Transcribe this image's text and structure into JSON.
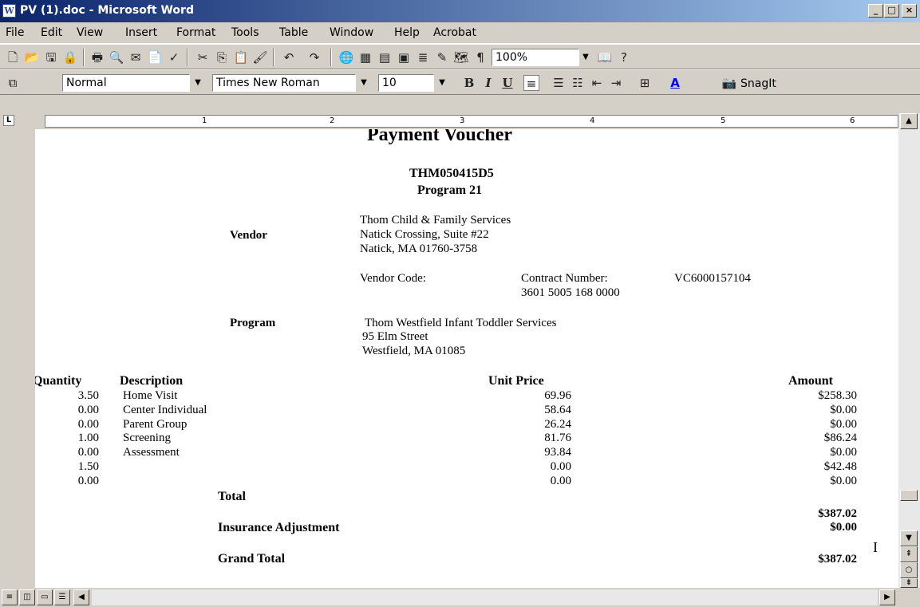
{
  "window": {
    "title": "PV (1).doc - Microsoft Word"
  },
  "menu": [
    "File",
    "Edit",
    "View",
    "Insert",
    "Format",
    "Tools",
    "Table",
    "Window",
    "Help",
    "Acrobat"
  ],
  "toolbar": {
    "zoom": "100%",
    "style": "Normal",
    "font": "Times New Roman",
    "size": "10",
    "snagit": "SnagIt"
  },
  "ruler": {
    "nums": [
      "1",
      "2",
      "3",
      "4",
      "5",
      "6"
    ]
  },
  "doc": {
    "title": "Payment Voucher",
    "voucher_id": "THM050415D5",
    "program_num": "Program 21",
    "vendor_label": "Vendor",
    "vendor_lines": [
      "Thom Child & Family Services",
      "Natick Crossing, Suite #22",
      "Natick, MA 01760-3758"
    ],
    "vendor_code_label": "Vendor Code:",
    "contract_label": "Contract Number:",
    "contract_value": "VC6000157104",
    "account": "3601 5005 168 0000",
    "program_label": "Program",
    "program_lines": [
      "Thom Westfield Infant Toddler Services",
      "95 Elm Street",
      "Westfield, MA 01085"
    ],
    "headers": {
      "qty": "Quantity",
      "desc": "Description",
      "price": "Unit Price",
      "amount": "Amount"
    },
    "rows": [
      {
        "qty": "3.50",
        "desc": "Home Visit",
        "price": "69.96",
        "amount": "$258.30"
      },
      {
        "qty": "0.00",
        "desc": "Center Individual",
        "price": "58.64",
        "amount": "$0.00"
      },
      {
        "qty": "0.00",
        "desc": "Parent Group",
        "price": "26.24",
        "amount": "$0.00"
      },
      {
        "qty": "1.00",
        "desc": "Screening",
        "price": "81.76",
        "amount": "$86.24"
      },
      {
        "qty": "0.00",
        "desc": "Assessment",
        "price": "93.84",
        "amount": "$0.00"
      },
      {
        "qty": "1.50",
        "desc": "",
        "price": "0.00",
        "amount": "$42.48"
      },
      {
        "qty": "0.00",
        "desc": "",
        "price": "0.00",
        "amount": "$0.00"
      }
    ],
    "total_label": "Total",
    "total_value": "$387.02",
    "ins_label": "Insurance Adjustment",
    "ins_value": "$0.00",
    "grand_label": "Grand Total",
    "grand_value": "$387.02"
  }
}
